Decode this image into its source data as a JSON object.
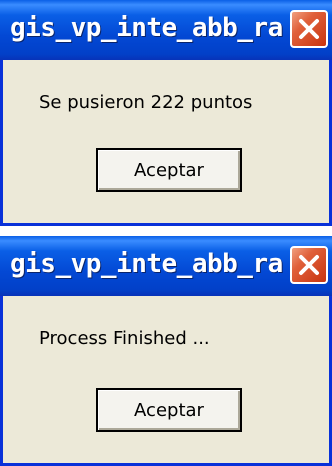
{
  "dialogs": [
    {
      "title": "gis_vp_inte_abb_ra",
      "message": "Se pusieron 222 puntos",
      "button_label": "Aceptar"
    },
    {
      "title": "gis_vp_inte_abb_ra",
      "message": "Process Finished ...",
      "button_label": "Aceptar"
    }
  ],
  "colors": {
    "titlebar": "#0348d4",
    "dialog_bg": "#ece9d8",
    "close_button": "#e0603a"
  },
  "icons": {
    "close": "close-icon"
  }
}
